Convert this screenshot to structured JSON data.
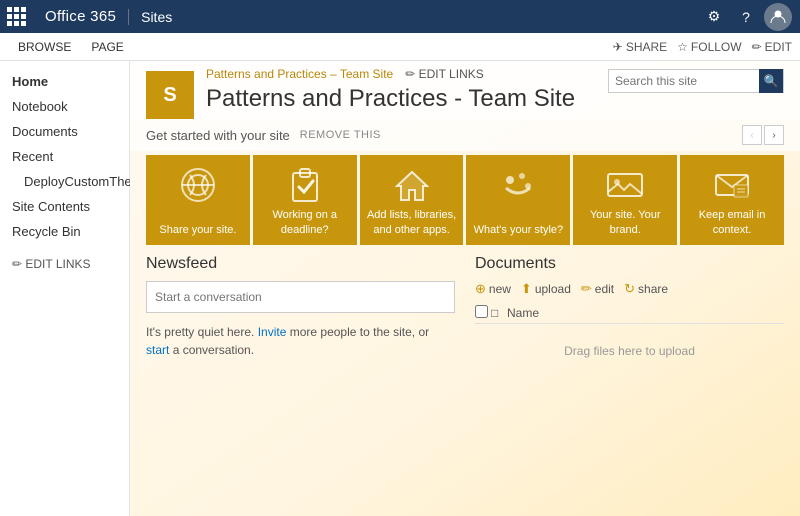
{
  "topbar": {
    "app_name": "Office 365",
    "section_name": "Sites",
    "gear_icon": "⚙",
    "question_icon": "?",
    "avatar_label": "User"
  },
  "secondbar": {
    "items": [
      "BROWSE",
      "PAGE"
    ],
    "actions": {
      "share": "SHARE",
      "follow": "FOLLOW",
      "edit": "EDIT"
    }
  },
  "sidebar": {
    "items": [
      {
        "label": "Home",
        "active": true
      },
      {
        "label": "Notebook"
      },
      {
        "label": "Documents"
      },
      {
        "label": "Recent"
      },
      {
        "label": "DeployCustomTheme",
        "indent": true
      },
      {
        "label": "Site Contents"
      },
      {
        "label": "Recycle Bin"
      }
    ],
    "edit_links": "✏ EDIT LINKS"
  },
  "site_header": {
    "breadcrumb_link": "Patterns and Practices – Team Site",
    "breadcrumb_sep": "–",
    "edit_links_label": "✏ EDIT LINKS",
    "title": "Patterns and Practices - Team Site",
    "search_placeholder": "Search this site"
  },
  "get_started": {
    "title": "Get started with your site",
    "remove_label": "REMOVE THIS",
    "nav_prev": "‹",
    "nav_next": "›"
  },
  "cards": [
    {
      "label": "Share your site.",
      "icon": "share"
    },
    {
      "label": "Working on a deadline?",
      "icon": "clipboard"
    },
    {
      "label": "Add lists, libraries, and other apps.",
      "icon": "house"
    },
    {
      "label": "What's your style?",
      "icon": "palette"
    },
    {
      "label": "Your site. Your brand.",
      "icon": "image"
    },
    {
      "label": "Keep email in context.",
      "icon": "email"
    }
  ],
  "newsfeed": {
    "title": "Newsfeed",
    "input_placeholder": "Start a conversation",
    "quiet_text": "It's pretty quiet here.",
    "invite_link": "Invite",
    "invite_suffix": " more people to the site, or",
    "start_link": "start",
    "start_suffix": " a conversation."
  },
  "documents": {
    "title": "Documents",
    "tools": [
      {
        "icon": "⊕",
        "label": "new"
      },
      {
        "icon": "⬆",
        "label": "upload"
      },
      {
        "icon": "✏",
        "label": "edit"
      },
      {
        "icon": "↻",
        "label": "share"
      }
    ],
    "columns": {
      "check": "✓",
      "icon": "□",
      "name": "Name"
    },
    "drag_text": "Drag files here to upload"
  }
}
